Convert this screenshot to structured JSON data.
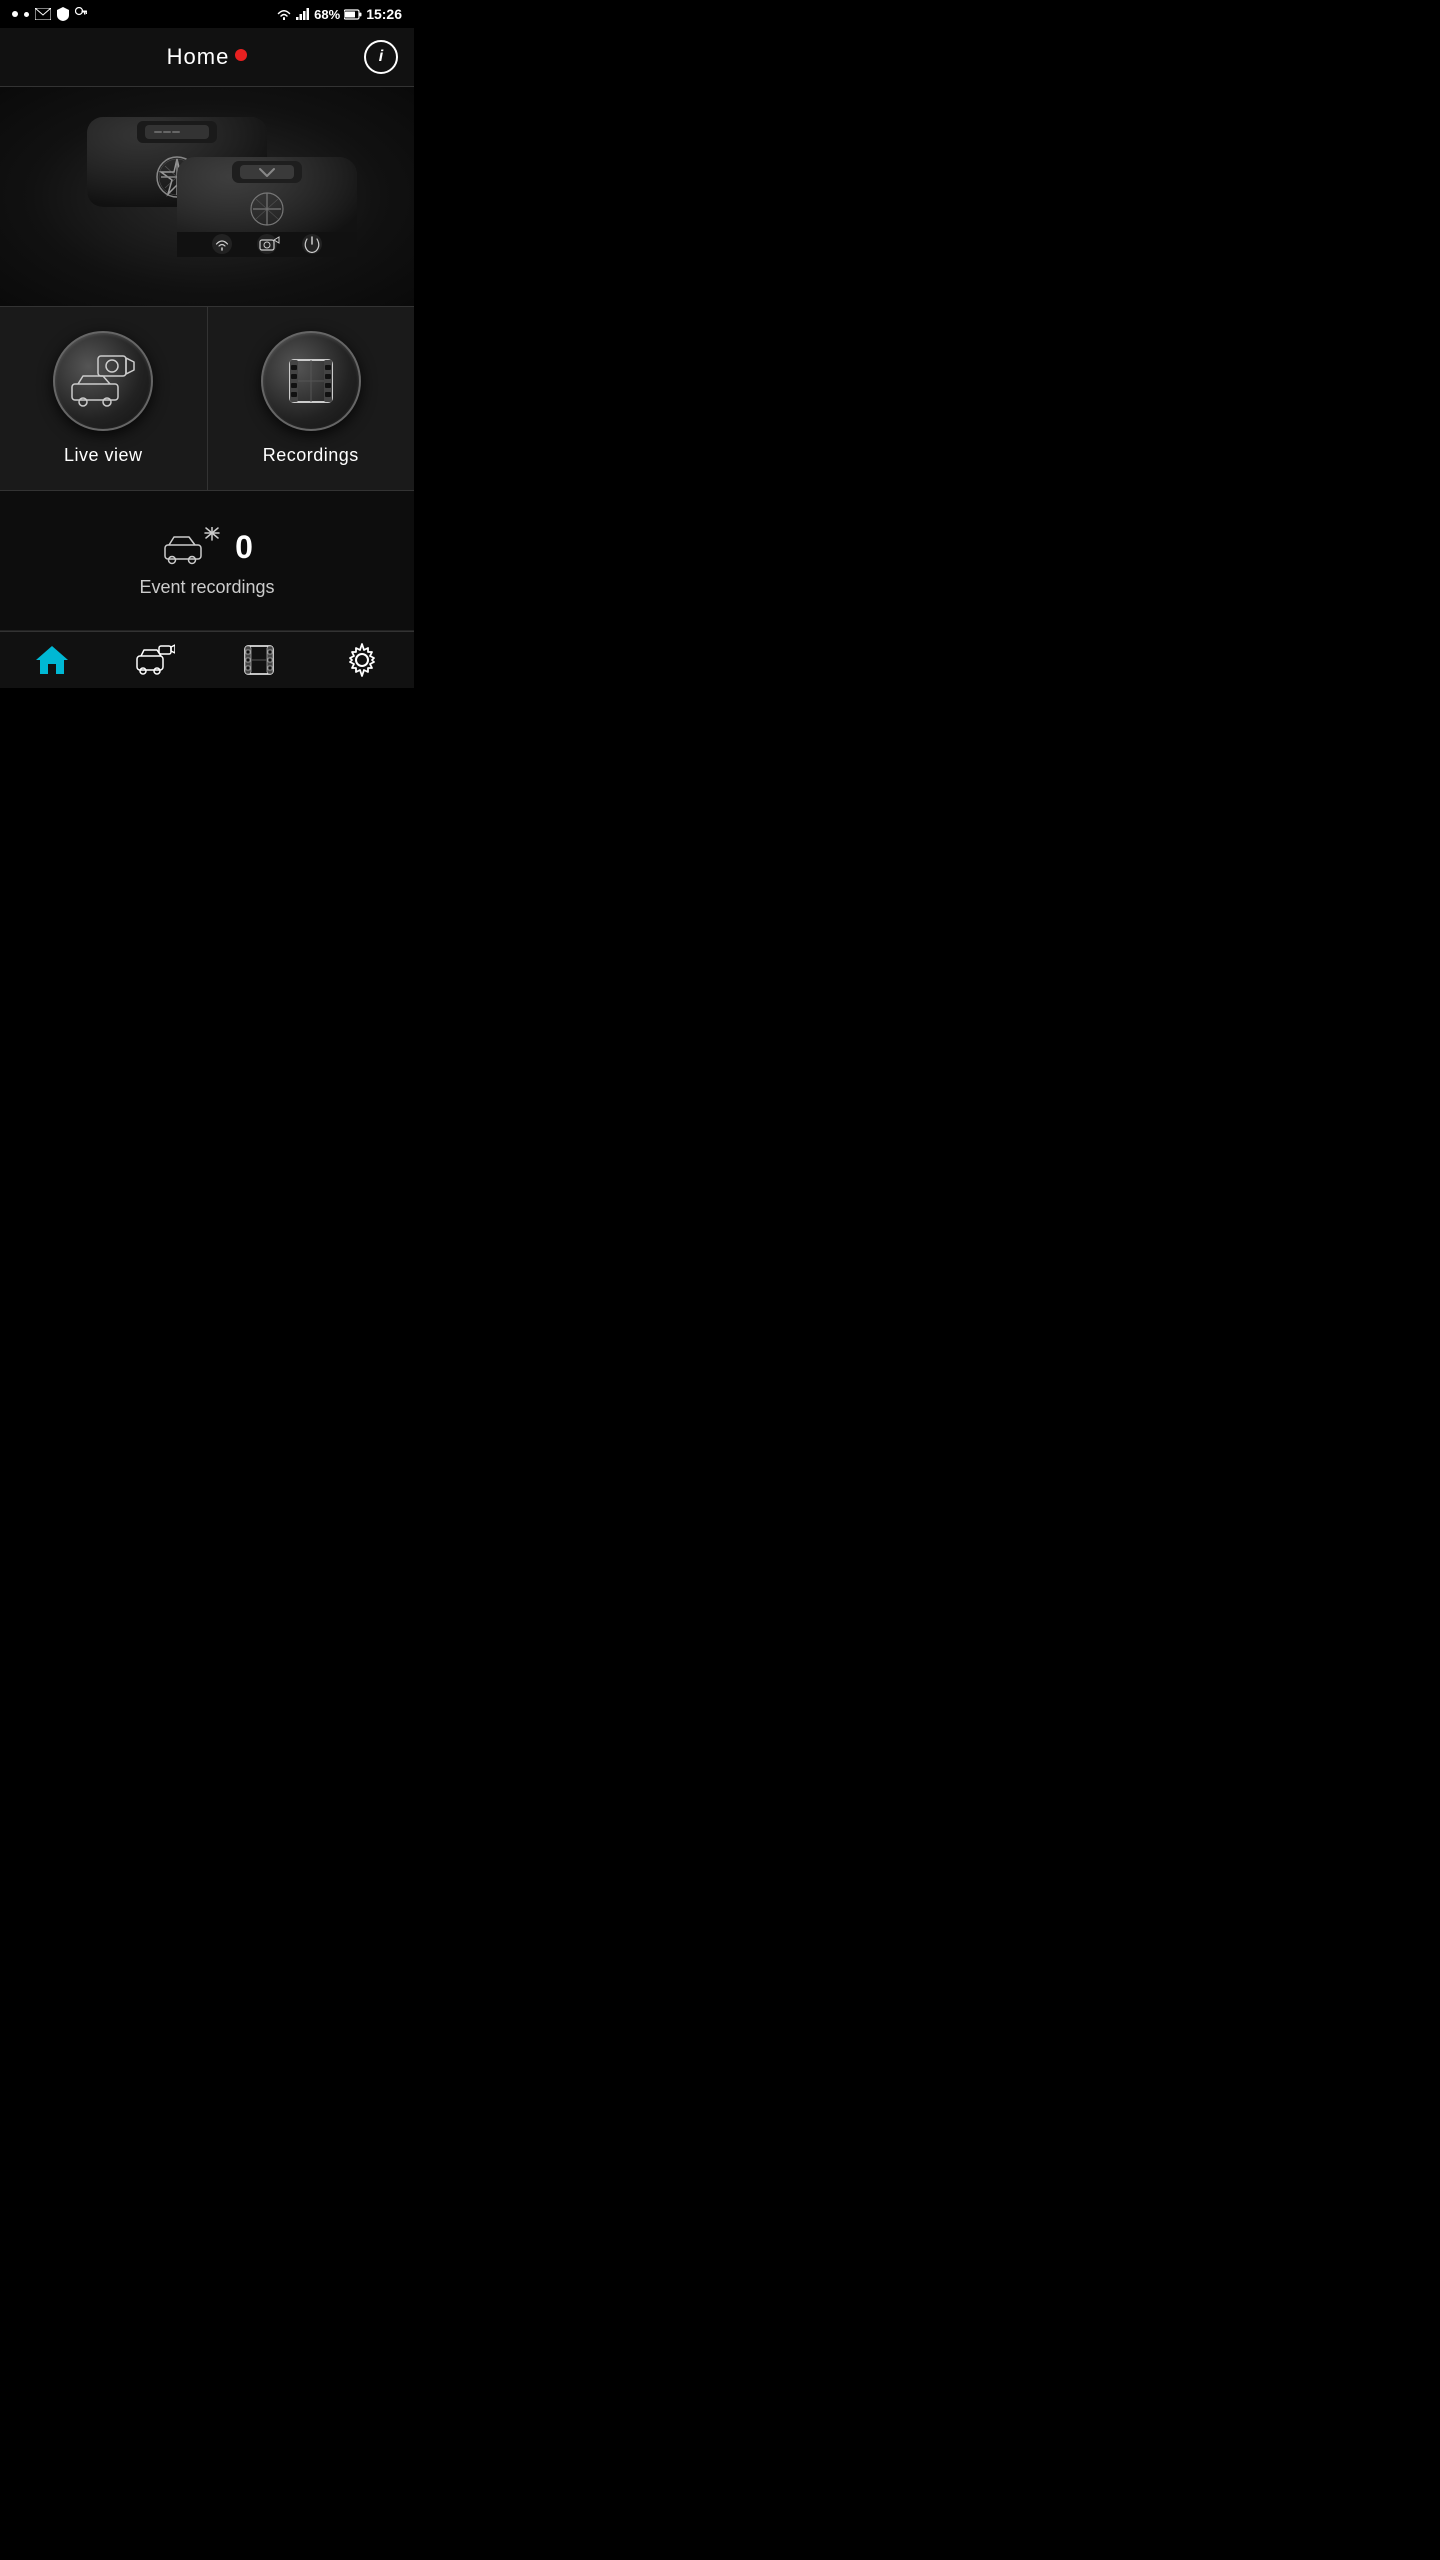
{
  "statusBar": {
    "battery": "68%",
    "time": "15:26",
    "batteryIcon": "battery-icon",
    "wifiIcon": "wifi-icon",
    "signalIcon": "signal-icon"
  },
  "header": {
    "title": "Home",
    "infoLabel": "i",
    "redDotVisible": true
  },
  "mainMenu": {
    "items": [
      {
        "id": "live-view",
        "label": "Live view",
        "icon": "camera-car-icon"
      },
      {
        "id": "recordings",
        "label": "Recordings",
        "icon": "film-strip-icon"
      }
    ]
  },
  "eventSection": {
    "count": "0",
    "label": "Event recordings"
  },
  "bottomNav": {
    "items": [
      {
        "id": "home",
        "label": "home",
        "icon": "home-icon",
        "active": true
      },
      {
        "id": "live",
        "label": "live",
        "icon": "live-icon",
        "active": false
      },
      {
        "id": "recordings",
        "label": "recordings",
        "icon": "recordings-icon",
        "active": false
      },
      {
        "id": "settings",
        "label": "settings",
        "icon": "settings-icon",
        "active": false
      }
    ]
  }
}
